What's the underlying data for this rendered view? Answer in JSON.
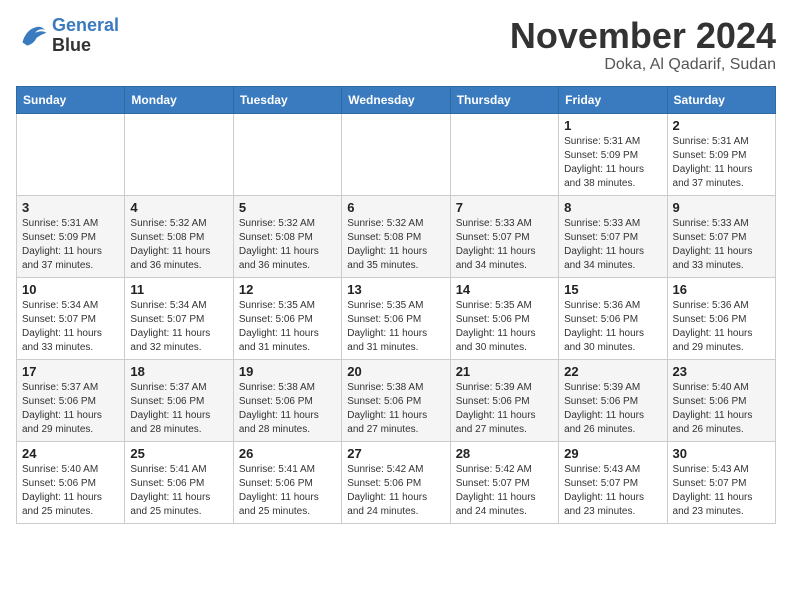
{
  "header": {
    "logo_line1": "General",
    "logo_line2": "Blue",
    "month": "November 2024",
    "location": "Doka, Al Qadarif, Sudan"
  },
  "weekdays": [
    "Sunday",
    "Monday",
    "Tuesday",
    "Wednesday",
    "Thursday",
    "Friday",
    "Saturday"
  ],
  "weeks": [
    [
      {
        "day": "",
        "info": ""
      },
      {
        "day": "",
        "info": ""
      },
      {
        "day": "",
        "info": ""
      },
      {
        "day": "",
        "info": ""
      },
      {
        "day": "",
        "info": ""
      },
      {
        "day": "1",
        "info": "Sunrise: 5:31 AM\nSunset: 5:09 PM\nDaylight: 11 hours\nand 38 minutes."
      },
      {
        "day": "2",
        "info": "Sunrise: 5:31 AM\nSunset: 5:09 PM\nDaylight: 11 hours\nand 37 minutes."
      }
    ],
    [
      {
        "day": "3",
        "info": "Sunrise: 5:31 AM\nSunset: 5:09 PM\nDaylight: 11 hours\nand 37 minutes."
      },
      {
        "day": "4",
        "info": "Sunrise: 5:32 AM\nSunset: 5:08 PM\nDaylight: 11 hours\nand 36 minutes."
      },
      {
        "day": "5",
        "info": "Sunrise: 5:32 AM\nSunset: 5:08 PM\nDaylight: 11 hours\nand 36 minutes."
      },
      {
        "day": "6",
        "info": "Sunrise: 5:32 AM\nSunset: 5:08 PM\nDaylight: 11 hours\nand 35 minutes."
      },
      {
        "day": "7",
        "info": "Sunrise: 5:33 AM\nSunset: 5:07 PM\nDaylight: 11 hours\nand 34 minutes."
      },
      {
        "day": "8",
        "info": "Sunrise: 5:33 AM\nSunset: 5:07 PM\nDaylight: 11 hours\nand 34 minutes."
      },
      {
        "day": "9",
        "info": "Sunrise: 5:33 AM\nSunset: 5:07 PM\nDaylight: 11 hours\nand 33 minutes."
      }
    ],
    [
      {
        "day": "10",
        "info": "Sunrise: 5:34 AM\nSunset: 5:07 PM\nDaylight: 11 hours\nand 33 minutes."
      },
      {
        "day": "11",
        "info": "Sunrise: 5:34 AM\nSunset: 5:07 PM\nDaylight: 11 hours\nand 32 minutes."
      },
      {
        "day": "12",
        "info": "Sunrise: 5:35 AM\nSunset: 5:06 PM\nDaylight: 11 hours\nand 31 minutes."
      },
      {
        "day": "13",
        "info": "Sunrise: 5:35 AM\nSunset: 5:06 PM\nDaylight: 11 hours\nand 31 minutes."
      },
      {
        "day": "14",
        "info": "Sunrise: 5:35 AM\nSunset: 5:06 PM\nDaylight: 11 hours\nand 30 minutes."
      },
      {
        "day": "15",
        "info": "Sunrise: 5:36 AM\nSunset: 5:06 PM\nDaylight: 11 hours\nand 30 minutes."
      },
      {
        "day": "16",
        "info": "Sunrise: 5:36 AM\nSunset: 5:06 PM\nDaylight: 11 hours\nand 29 minutes."
      }
    ],
    [
      {
        "day": "17",
        "info": "Sunrise: 5:37 AM\nSunset: 5:06 PM\nDaylight: 11 hours\nand 29 minutes."
      },
      {
        "day": "18",
        "info": "Sunrise: 5:37 AM\nSunset: 5:06 PM\nDaylight: 11 hours\nand 28 minutes."
      },
      {
        "day": "19",
        "info": "Sunrise: 5:38 AM\nSunset: 5:06 PM\nDaylight: 11 hours\nand 28 minutes."
      },
      {
        "day": "20",
        "info": "Sunrise: 5:38 AM\nSunset: 5:06 PM\nDaylight: 11 hours\nand 27 minutes."
      },
      {
        "day": "21",
        "info": "Sunrise: 5:39 AM\nSunset: 5:06 PM\nDaylight: 11 hours\nand 27 minutes."
      },
      {
        "day": "22",
        "info": "Sunrise: 5:39 AM\nSunset: 5:06 PM\nDaylight: 11 hours\nand 26 minutes."
      },
      {
        "day": "23",
        "info": "Sunrise: 5:40 AM\nSunset: 5:06 PM\nDaylight: 11 hours\nand 26 minutes."
      }
    ],
    [
      {
        "day": "24",
        "info": "Sunrise: 5:40 AM\nSunset: 5:06 PM\nDaylight: 11 hours\nand 25 minutes."
      },
      {
        "day": "25",
        "info": "Sunrise: 5:41 AM\nSunset: 5:06 PM\nDaylight: 11 hours\nand 25 minutes."
      },
      {
        "day": "26",
        "info": "Sunrise: 5:41 AM\nSunset: 5:06 PM\nDaylight: 11 hours\nand 25 minutes."
      },
      {
        "day": "27",
        "info": "Sunrise: 5:42 AM\nSunset: 5:06 PM\nDaylight: 11 hours\nand 24 minutes."
      },
      {
        "day": "28",
        "info": "Sunrise: 5:42 AM\nSunset: 5:07 PM\nDaylight: 11 hours\nand 24 minutes."
      },
      {
        "day": "29",
        "info": "Sunrise: 5:43 AM\nSunset: 5:07 PM\nDaylight: 11 hours\nand 23 minutes."
      },
      {
        "day": "30",
        "info": "Sunrise: 5:43 AM\nSunset: 5:07 PM\nDaylight: 11 hours\nand 23 minutes."
      }
    ]
  ]
}
